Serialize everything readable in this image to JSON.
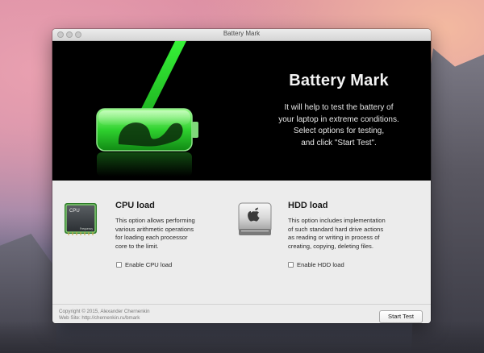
{
  "window": {
    "title": "Battery Mark"
  },
  "hero": {
    "title": "Battery Mark",
    "description_lines": [
      "It will help to test the battery of",
      "your laptop in extreme conditions.",
      "Select options for testing,",
      "and click \"Start Test\"."
    ]
  },
  "cpu": {
    "icon": "cpu-chip-icon",
    "chip_label": "CPU",
    "chip_sublabel": "Frequency",
    "heading": "CPU load",
    "description_lines": [
      "This option allows performing",
      "various arithmetic operations",
      "for loading each processor",
      "core to the limit."
    ],
    "checkbox_label": "Enable CPU load",
    "checked": false
  },
  "hdd": {
    "icon": "hard-drive-icon",
    "heading": "HDD load",
    "description_lines": [
      "This option includes implementation",
      "of such standard hard drive actions",
      "as reading or writing in process of",
      "creating, copying, deleting files."
    ],
    "checkbox_label": "Enable HDD load",
    "checked": false
  },
  "footer": {
    "copyright": "Copyright © 2015, Alexander Chernenkin",
    "website": "Web Site: http://chernenkin.ru/bmark",
    "start_button": "Start Test"
  },
  "colors": {
    "accent_green": "#39ff3a",
    "hero_bg": "#000000",
    "window_bg": "#ececec"
  }
}
